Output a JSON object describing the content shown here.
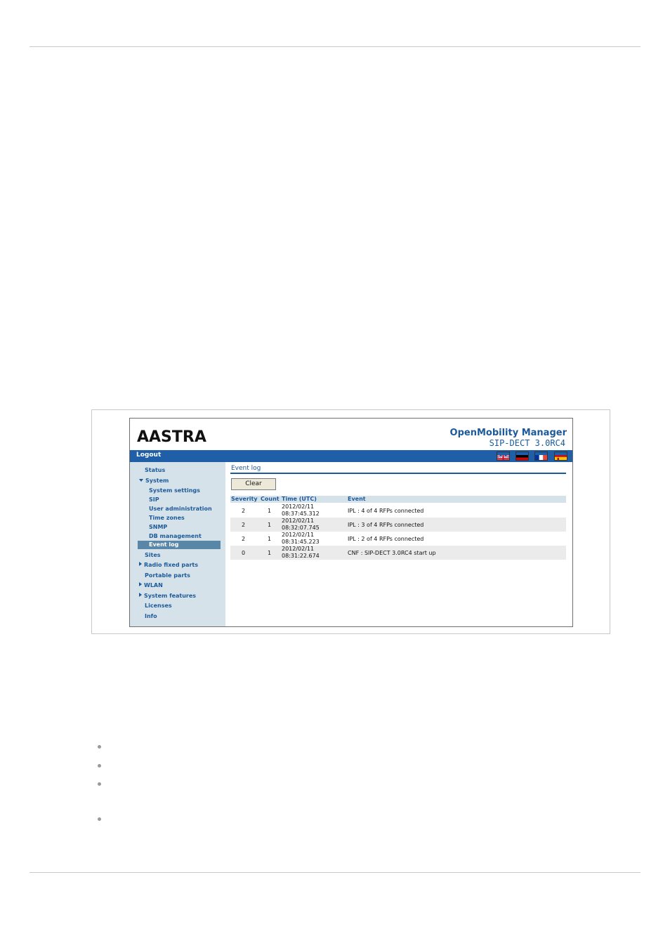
{
  "app": {
    "logo": "AASTRA",
    "title": "OpenMobility Manager",
    "version": "SIP-DECT 3.0RC4"
  },
  "topbar": {
    "logout_label": "Logout",
    "languages": [
      "english-flag-icon",
      "german-flag-icon",
      "french-flag-icon",
      "spanish-flag-icon"
    ]
  },
  "sidebar": {
    "items": [
      {
        "label": "Status",
        "level": 0,
        "expander": "none",
        "active": false
      },
      {
        "label": "System",
        "level": 0,
        "expander": "expanded",
        "active": false
      },
      {
        "label": "System settings",
        "level": 1,
        "expander": "none",
        "active": false
      },
      {
        "label": "SIP",
        "level": 1,
        "expander": "none",
        "active": false
      },
      {
        "label": "User administration",
        "level": 1,
        "expander": "none",
        "active": false
      },
      {
        "label": "Time zones",
        "level": 1,
        "expander": "none",
        "active": false
      },
      {
        "label": "SNMP",
        "level": 1,
        "expander": "none",
        "active": false
      },
      {
        "label": "DB management",
        "level": 1,
        "expander": "none",
        "active": false
      },
      {
        "label": "Event log",
        "level": 1,
        "expander": "none",
        "active": true
      },
      {
        "label": "Sites",
        "level": 0,
        "expander": "none",
        "active": false
      },
      {
        "label": "Radio fixed parts",
        "level": 0,
        "expander": "collapsed",
        "active": false
      },
      {
        "label": "Portable parts",
        "level": 0,
        "expander": "none",
        "active": false
      },
      {
        "label": "WLAN",
        "level": 0,
        "expander": "collapsed",
        "active": false
      },
      {
        "label": "System features",
        "level": 0,
        "expander": "collapsed",
        "active": false
      },
      {
        "label": "Licenses",
        "level": 0,
        "expander": "none",
        "active": false
      },
      {
        "label": "Info",
        "level": 0,
        "expander": "none",
        "active": false
      }
    ]
  },
  "content": {
    "page_title": "Event log",
    "clear_label": "Clear",
    "columns": [
      "Severity",
      "Count",
      "Time (UTC)",
      "Event"
    ],
    "rows": [
      {
        "severity": "2",
        "count": "1",
        "date": "2012/02/11",
        "time": "08:37:45.312",
        "event": "IPL : 4 of 4 RFPs connected"
      },
      {
        "severity": "2",
        "count": "1",
        "date": "2012/02/11",
        "time": "08:32:07.745",
        "event": "IPL : 3 of 4 RFPs connected"
      },
      {
        "severity": "2",
        "count": "1",
        "date": "2012/02/11",
        "time": "08:31:45.223",
        "event": "IPL : 2 of 4 RFPs connected"
      },
      {
        "severity": "0",
        "count": "1",
        "date": "2012/02/11",
        "time": "08:31:22.674",
        "event": "CNF : SIP-DECT 3.0RC4 start up"
      }
    ]
  },
  "colors": {
    "brand_blue": "#1f5fa8",
    "link_blue": "#1d5a9a",
    "sidebar_bg": "#d6e2ea",
    "active_item": "#5a87a8",
    "row_alt": "#ebebeb"
  }
}
